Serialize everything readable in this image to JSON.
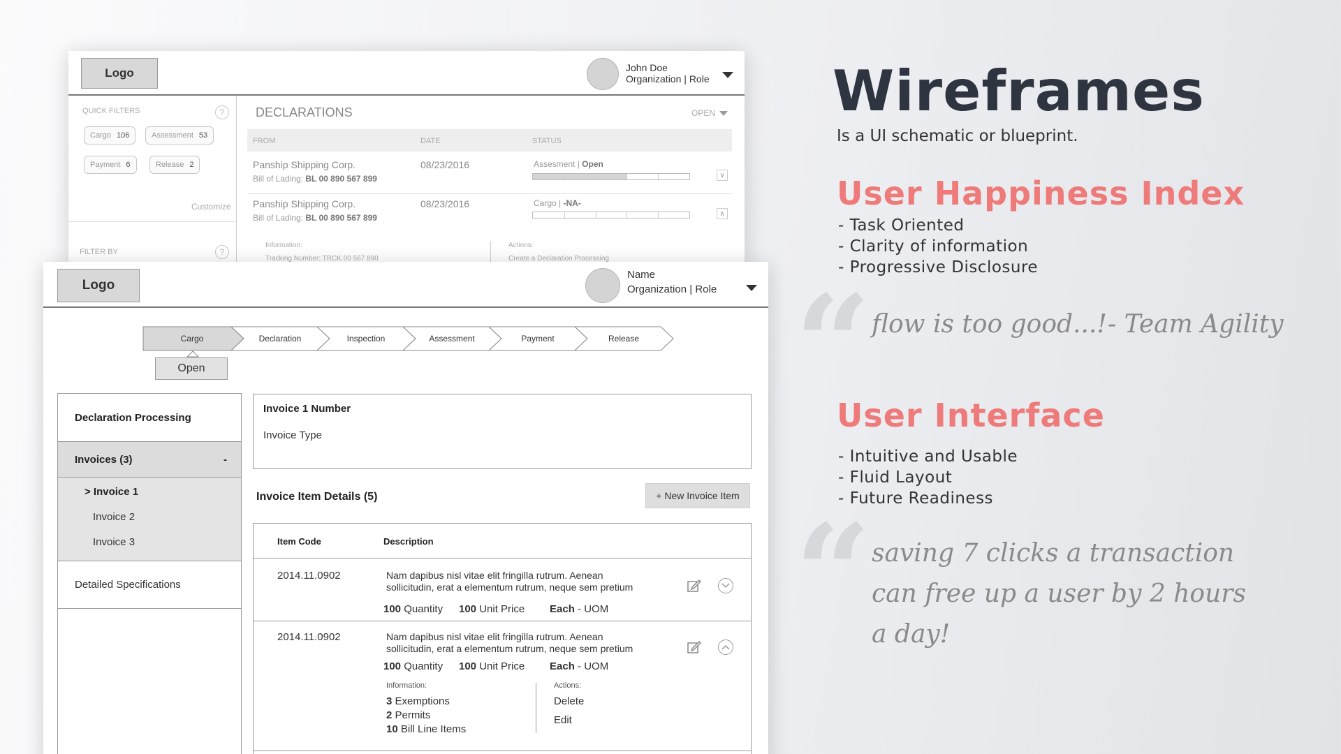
{
  "back_window": {
    "logo": "Logo",
    "user_name": "John Doe",
    "user_org": "Organization",
    "user_sep": "|",
    "user_role": "Role",
    "quick_filters_label": "QUICK FILTERS",
    "help": "?",
    "pills": [
      {
        "label": "Cargo",
        "count": "106"
      },
      {
        "label": "Assessment",
        "count": "53"
      },
      {
        "label": "Payment",
        "count": "6"
      },
      {
        "label": "Release",
        "count": "2"
      }
    ],
    "customize": "Customize",
    "filter_by": "FILTER BY",
    "title": "DECLARATIONS",
    "open_filter": "OPEN",
    "col_from": "FROM",
    "col_date": "DATE",
    "col_status": "STATUS",
    "rows": [
      {
        "company": "Panship Shipping Corp.",
        "bol_label": "Bill of Lading:",
        "bol_value": "BL 00 890 567 899",
        "date": "08/23/2016",
        "status_stage": "Assesment",
        "status_value": "Open",
        "progress": 0.6
      },
      {
        "company": "Panship Shipping Corp.",
        "bol_label": "Bill of Lading:",
        "bol_value": "BL 00 890 567 899",
        "date": "08/23/2016",
        "status_stage": "Cargo",
        "status_value": "-NA-",
        "progress": 0.0
      }
    ],
    "info_label": "Information:",
    "tracking": "Tracking Number: TRCK 00 567 890",
    "actions_label": "Actions:",
    "create_action": "Create a Declaration Processing"
  },
  "front_window": {
    "logo": "Logo",
    "user_name": "Name",
    "user_org": "Organization",
    "user_sep": "|",
    "user_role": "Role",
    "steps": [
      "Cargo",
      "Declaration",
      "Inspection",
      "Assessment",
      "Payment",
      "Release"
    ],
    "current_status": "Open",
    "sidebar": {
      "declaration_processing": "Declaration Processing",
      "invoices_header": "Invoices (3)",
      "collapse": "-",
      "invoices": [
        "> Invoice 1",
        "Invoice 2",
        "Invoice 3"
      ],
      "detailed_specs": "Detailed Specifications"
    },
    "invoice_number": "Invoice 1 Number",
    "invoice_type": "Invoice Type",
    "item_details_title": "Invoice Item Details (5)",
    "new_item_button": "+ New Invoice Item",
    "col_item_code": "Item Code",
    "col_description": "Description",
    "items": [
      {
        "code": "2014.11.0902",
        "desc1": "Nam dapibus nisl vitae elit fringilla rutrum. Aenean",
        "desc2": "sollicitudin, erat a elementum rutrum, neque sem pretium",
        "qty": "100",
        "qty_label": "Quantity",
        "price": "100",
        "price_label": "Unit Price",
        "uom_strong": "Each",
        "uom_rest": "- UOM"
      },
      {
        "code": "2014.11.0902",
        "desc1": "Nam dapibus nisl vitae elit fringilla rutrum. Aenean",
        "desc2": "sollicitudin, erat a elementum rutrum, neque sem pretium",
        "qty": "100",
        "qty_label": "Quantity",
        "price": "100",
        "price_label": "Unit Price",
        "uom_strong": "Each",
        "uom_rest": "- UOM"
      }
    ],
    "expanded": {
      "info_label": "Information:",
      "info": [
        {
          "n": "3",
          "t": "Exemptions"
        },
        {
          "n": "2",
          "t": "Permits"
        },
        {
          "n": "10",
          "t": "Bill Line Items"
        }
      ],
      "actions_label": "Actions:",
      "actions": [
        "Delete",
        "Edit"
      ]
    }
  },
  "right_panel": {
    "title": "Wireframes",
    "subtitle": "Is a UI schematic or blueprint.",
    "happiness_title": "User Happiness Index",
    "happiness_items": [
      "- Task Oriented",
      "- Clarity of information",
      "- Progressive Disclosure"
    ],
    "quote1": "flow is too good...!",
    "quote1_author": "- Team Agility",
    "ui_title": "User Interface",
    "ui_items": [
      "- Intuitive and Usable",
      "- Fluid Layout",
      "- Future Readiness"
    ],
    "quote2_lines": [
      "saving 7 clicks a transaction",
      "can free up a user by 2 hours",
      "a day!"
    ],
    "quote_glyph": "“",
    "accent_color": "#ee7a7a",
    "title_color": "#2e3440"
  }
}
